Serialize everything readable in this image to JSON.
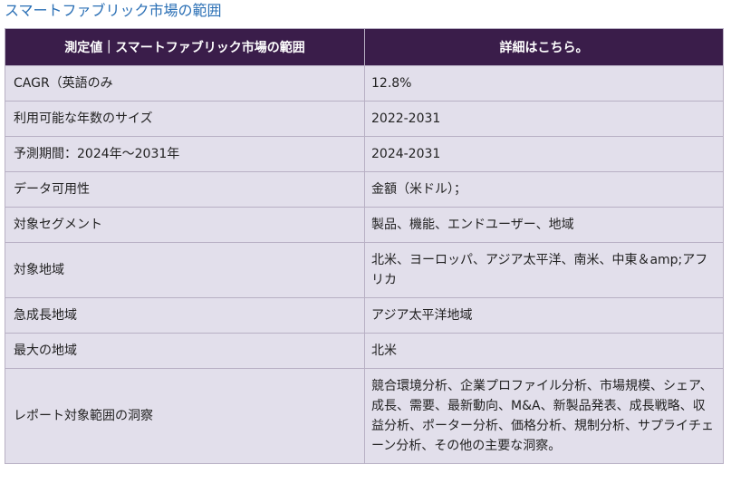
{
  "title": "スマートファブリック市場の範囲",
  "table": {
    "header": {
      "col1": "測定値｜スマートファブリック市場の範囲",
      "col2": "詳細はこちら。"
    },
    "rows": [
      {
        "label": "CAGR（英語のみ",
        "value": "12.8%"
      },
      {
        "label": "利用可能な年数のサイズ",
        "value": "2022-2031"
      },
      {
        "label": "予測期間：2024年～2031年",
        "value": "2024-2031"
      },
      {
        "label": "データ可用性",
        "value": "金額（米ドル）；"
      },
      {
        "label": "対象セグメント",
        "value": "製品、機能、エンドユーザー、地域"
      },
      {
        "label": "対象地域",
        "value": "北米、ヨーロッパ、アジア太平洋、南米、中東＆amp;アフリカ"
      },
      {
        "label": "急成長地域",
        "value": "アジア太平洋地域"
      },
      {
        "label": "最大の地域",
        "value": "北米"
      },
      {
        "label": "レポート対象範囲の洞察",
        "value": "競合環境分析、企業プロファイル分析、市場規模、シェア、成長、需要、最新動向、M&A、新製品発表、成長戦略、収益分析、ポーター分析、価格分析、規制分析、サプライチェーン分析、その他の主要な洞察。"
      }
    ]
  }
}
